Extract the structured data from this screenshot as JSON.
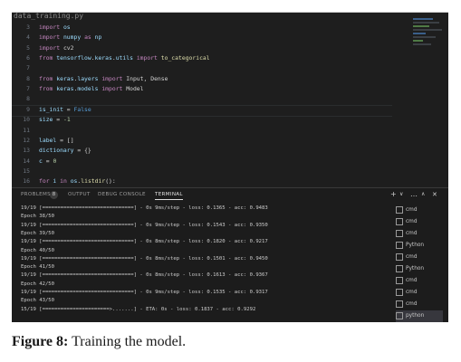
{
  "editor": {
    "filename": "data_training.py",
    "lines": [
      {
        "n": "3",
        "code": "import os"
      },
      {
        "n": "4",
        "code": "import numpy as np"
      },
      {
        "n": "5",
        "code": "import cv2"
      },
      {
        "n": "6",
        "code": "from tensorflow.keras.utils import to_categorical"
      },
      {
        "n": "7",
        "code": ""
      },
      {
        "n": "8",
        "code": "from keras.layers import Input, Dense"
      },
      {
        "n": "7",
        "code": "from keras.models import Model"
      },
      {
        "n": "8",
        "code": ""
      },
      {
        "n": "9",
        "code": "is_init = False"
      },
      {
        "n": "10",
        "code": "size = -1"
      },
      {
        "n": "11",
        "code": ""
      },
      {
        "n": "12",
        "code": "label = []"
      },
      {
        "n": "13",
        "code": "dictionary = {}"
      },
      {
        "n": "14",
        "code": "c = 0"
      },
      {
        "n": "15",
        "code": ""
      },
      {
        "n": "16",
        "code": "for i in os.listdir():"
      }
    ]
  },
  "panel": {
    "tabs": [
      "PROBLEMS",
      "OUTPUT",
      "DEBUG CONSOLE",
      "TERMINAL"
    ],
    "problems_count": "8",
    "actions": [
      "+",
      "∨",
      "…",
      "∧",
      "✕"
    ]
  },
  "terminal": {
    "lines": [
      "19/19 [==============================] - 0s 9ms/step - loss: 0.1365 - acc: 0.9483",
      "Epoch 38/50",
      "19/19 [==============================] - 0s 9ms/step - loss: 0.1543 - acc: 0.9350",
      "Epoch 39/50",
      "19/19 [==============================] - 0s 8ms/step - loss: 0.1820 - acc: 0.9217",
      "Epoch 40/50",
      "19/19 [==============================] - 0s 8ms/step - loss: 0.1501 - acc: 0.9450",
      "Epoch 41/50",
      "19/19 [==============================] - 0s 8ms/step - loss: 0.1613 - acc: 0.9367",
      "Epoch 42/50",
      "19/19 [==============================] - 0s 9ms/step - loss: 0.1535 - acc: 0.9317",
      "Epoch 43/50",
      "15/19 [======================>.......] - ETA: 0s - loss: 0.1837 - acc: 0.9292"
    ]
  },
  "terminal_list": [
    {
      "label": "cmd",
      "icon": "cmd-icon"
    },
    {
      "label": "cmd",
      "icon": "cmd-icon"
    },
    {
      "label": "cmd",
      "icon": "cmd-icon"
    },
    {
      "label": "Python",
      "icon": "python-icon"
    },
    {
      "label": "cmd",
      "icon": "cmd-icon"
    },
    {
      "label": "Python",
      "icon": "python-icon"
    },
    {
      "label": "cmd",
      "icon": "cmd-icon"
    },
    {
      "label": "cmd",
      "icon": "cmd-icon"
    },
    {
      "label": "cmd",
      "icon": "cmd-icon"
    },
    {
      "label": "python",
      "icon": "python-icon"
    }
  ],
  "caption": {
    "label": "Figure 8:",
    "text": " Training the model."
  }
}
